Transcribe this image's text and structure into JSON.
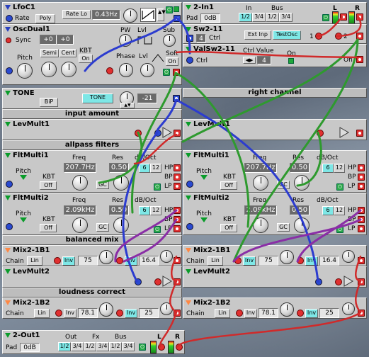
{
  "lfo": {
    "title": "LfoC1",
    "rate_label": "Rate",
    "poly": "Poly",
    "rate_lo": "Rate Lo",
    "rate_value": "0.43Hz"
  },
  "in1": {
    "title": "2-In1",
    "pad_label": "Pad",
    "pad_value": "0dB",
    "in_label": "In",
    "bus_label": "Bus",
    "opt1": "1/2",
    "opt2": "3/4",
    "opt3": "1/2",
    "opt4": "3/4",
    "l": "L",
    "r": "R"
  },
  "osc": {
    "title": "OscDual1",
    "sync": "Sync",
    "val1": "+0",
    "val2": "+0",
    "pw": "PW",
    "lvl1": "Lvl",
    "sub": "Sub",
    "pitch": "Pitch",
    "semi": "Semi",
    "cent": "Cent",
    "kbt": "KBT",
    "on": "On",
    "phase": "Phase",
    "lvl2": "Lvl",
    "soft": "Soft",
    "soft_on": "On"
  },
  "sw": {
    "title": "Sw2-11",
    "ctrl_value": "4",
    "ctrl_label": "Ctrl",
    "ext": "Ext Inp",
    "test": "TestOsc",
    "one": "1",
    "two": "2"
  },
  "valsw": {
    "title": "ValSw2-11",
    "ctrl_value_label": "Ctrl Value",
    "ctrl": "Ctrl",
    "value": "4",
    "on_label": "On",
    "on2": "On"
  },
  "tone": {
    "title": "TONE",
    "bip": "BiP",
    "tone_btn": "TONE",
    "value": "-21"
  },
  "sections": {
    "input_amount": "input amount",
    "right_channel": "right channel",
    "allpass": "allpass filters",
    "balanced": "balanced mix",
    "loudness": "loudness correct"
  },
  "levmult1": {
    "title": "LevMult1"
  },
  "levmult1r": {
    "title": "LevMult1"
  },
  "flt1": {
    "title": "FltMulti1",
    "freq": "Freq",
    "freq_value": "207.7Hz",
    "res": "Res",
    "res_value": "0.50",
    "db": "dB/Oct",
    "o6": "6",
    "o12": "12",
    "pitch": "Pitch",
    "kbt": "KBT",
    "off": "Off",
    "gc": "GC",
    "hp": "HP",
    "bp": "BP",
    "lp": "LP"
  },
  "flt1r": {
    "title": "FltMulti1",
    "freq": "Freq",
    "freq_value": "207.7Hz",
    "res": "Res",
    "res_value": "0.50",
    "db": "dB/Oct",
    "o6": "6",
    "o12": "12",
    "pitch": "Pitch",
    "kbt": "KBT",
    "off": "Off",
    "gc": "GC",
    "hp": "HP",
    "bp": "BP",
    "lp": "LP"
  },
  "flt2": {
    "title": "FltMulti2",
    "freq": "Freq",
    "freq_value": "2.09kHz",
    "res": "Res",
    "res_value": "0.50",
    "db": "dB/Oct",
    "o6": "6",
    "o12": "12",
    "pitch": "Pitch",
    "kbt": "KBT",
    "off": "Off",
    "gc": "GC",
    "hp": "HP",
    "bp": "BP",
    "lp": "LP"
  },
  "flt2r": {
    "title": "FltMulti2",
    "freq": "Freq",
    "freq_value": "2.09kHz",
    "res": "Res",
    "res_value": "0.50",
    "db": "dB/Oct",
    "o6": "6",
    "o12": "12",
    "pitch": "Pitch",
    "kbt": "KBT",
    "off": "Off",
    "gc": "GC",
    "hp": "HP",
    "bp": "BP",
    "lp": "LP"
  },
  "mix1": {
    "title": "Mix2-1B1",
    "chain": "Chain",
    "lin": "Lin",
    "inv1": "Inv",
    "v1": "75",
    "inv2": "Inv",
    "v2": "16.4"
  },
  "mix1r": {
    "title": "Mix2-1B1",
    "chain": "Chain",
    "lin": "Lin",
    "inv1": "Inv",
    "v1": "75",
    "inv2": "Inv",
    "v2": "16.4"
  },
  "levmult2": {
    "title": "LevMult2"
  },
  "levmult2r": {
    "title": "LevMult2"
  },
  "mix2": {
    "title": "Mix2-1B2",
    "chain": "Chain",
    "lin": "Lin",
    "inv1": "Inv",
    "v1": "78.1",
    "inv2": "Inv",
    "v2": "25"
  },
  "mix2r": {
    "title": "Mix2-1B2",
    "chain": "Chain",
    "lin": "Lin",
    "inv1": "Inv",
    "v1": "78.1",
    "inv2": "Inv",
    "v2": "25"
  },
  "out": {
    "title": "2-Out1",
    "pad_label": "Pad",
    "pad_value": "0dB",
    "out_label": "Out",
    "fx_label": "Fx",
    "bus_label": "Bus",
    "o1": "1/2",
    "o2": "3/4",
    "f1": "1/2",
    "f2": "3/4",
    "b1": "1/2",
    "b2": "3/4",
    "l": "L",
    "r": "R"
  }
}
